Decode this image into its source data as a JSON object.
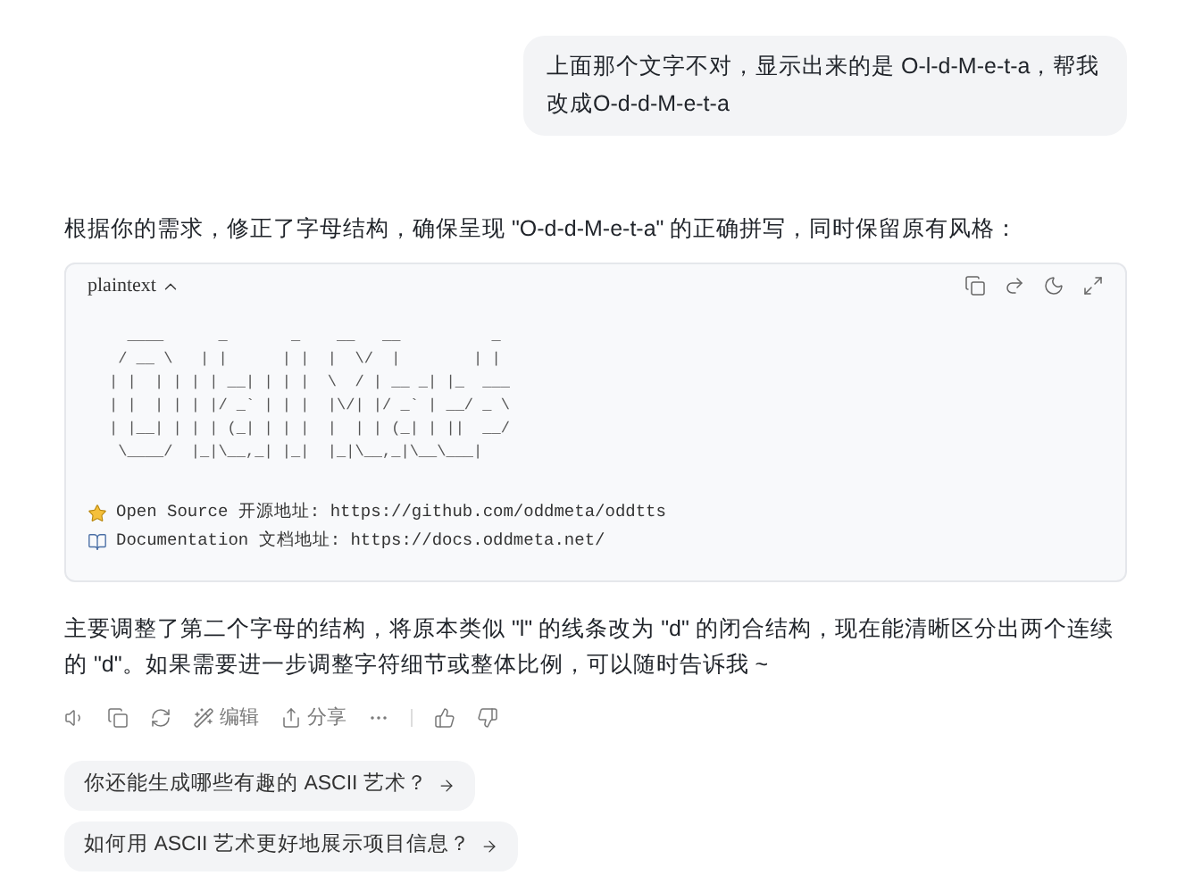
{
  "user_message": "上面那个文字不对，显示出来的是 O-l-d-M-e-t-a，帮我改成O-d-d-M-e-t-a",
  "reply_intro": "根据你的需求，修正了字母结构，确保呈现 \"O-d-d-M-e-t-a\" 的正确拼写，同时保留原有风格：",
  "code_block": {
    "language": "plaintext",
    "expanded": true,
    "art_lines": [
      "  ____      _       _    __   __          _",
      " / __ \\   | |      | |  |  \\/  |        | |",
      "| |  | | | | __| | | |  \\  / | __ _| |_  ___",
      "| |  | | | |/ _` | | |  |\\/| |/ _` | __/ _ \\",
      "| |__| | | | (_| | | |  |  | | (_| | ||  __/",
      " \\____/  |_|\\__,_| |_|  |_|\\__,_|\\__\\___|"
    ],
    "links": [
      {
        "kind": "star",
        "text": "Open Source 开源地址: https://github.com/oddmeta/oddtts"
      },
      {
        "kind": "book",
        "text": "Documentation 文档地址: https://docs.oddmeta.net/"
      }
    ]
  },
  "reply_outro": "主要调整了第二个字母的结构，将原本类似 \"l\" 的线条改为 \"d\" 的闭合结构，现在能清晰区分出两个连续的 \"d\"。如果需要进一步调整字符细节或整体比例，可以随时告诉我 ~",
  "actions": [
    {
      "kind": "speaker"
    },
    {
      "kind": "copy"
    },
    {
      "kind": "refresh"
    },
    {
      "kind": "edit",
      "label": "编辑"
    },
    {
      "kind": "share",
      "label": "分享"
    },
    {
      "kind": "more"
    },
    {
      "kind": "like"
    },
    {
      "kind": "dislike"
    }
  ],
  "suggestions": [
    "你还能生成哪些有趣的 ASCII 艺术？",
    "如何用 ASCII 艺术更好地展示项目信息？"
  ]
}
